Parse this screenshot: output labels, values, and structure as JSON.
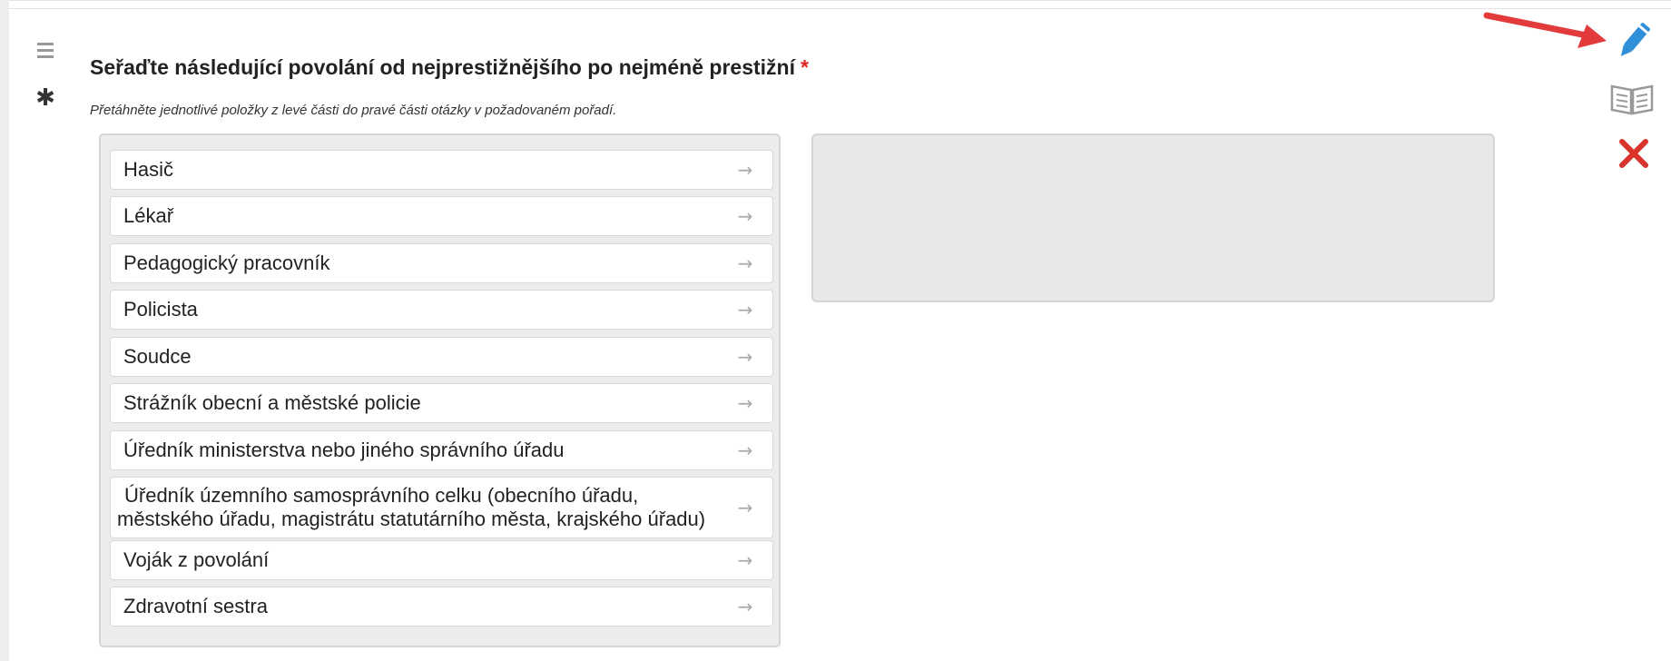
{
  "question": {
    "title": "Seřaďte následující povolání od nejprestižnějšího po nejméně prestižní",
    "required_mark": "*",
    "help": "Přetáhněte jednotlivé položky z levé části do pravé části otázky v požadovaném pořadí."
  },
  "items": [
    {
      "label": "Hasič"
    },
    {
      "label": "Lékař"
    },
    {
      "label": "Pedagogický pracovník"
    },
    {
      "label": "Policista"
    },
    {
      "label": "Soudce"
    },
    {
      "label": "Strážník obecní a městské policie"
    },
    {
      "label": "Úředník ministerstva nebo jiného správního úřadu"
    },
    {
      "label": "Úředník územního samosprávního celku (obecního úřadu, městského úřadu, magistrátu statutárního města, krajského úřadu)"
    },
    {
      "label": "Voják z povolání"
    },
    {
      "label": "Zdravotní sestra"
    }
  ],
  "icons": {
    "menu": "hamburger-icon",
    "mandatory": "asterisk-icon",
    "edit": "pencil-icon",
    "preview": "book-icon",
    "delete": "close-icon",
    "annotation": "red-arrow-icon",
    "move": "arrow-right-icon"
  },
  "colors": {
    "required": "#e02525",
    "edit": "#2f8fd8",
    "delete": "#d9342b",
    "annotation": "#e33b3b"
  }
}
